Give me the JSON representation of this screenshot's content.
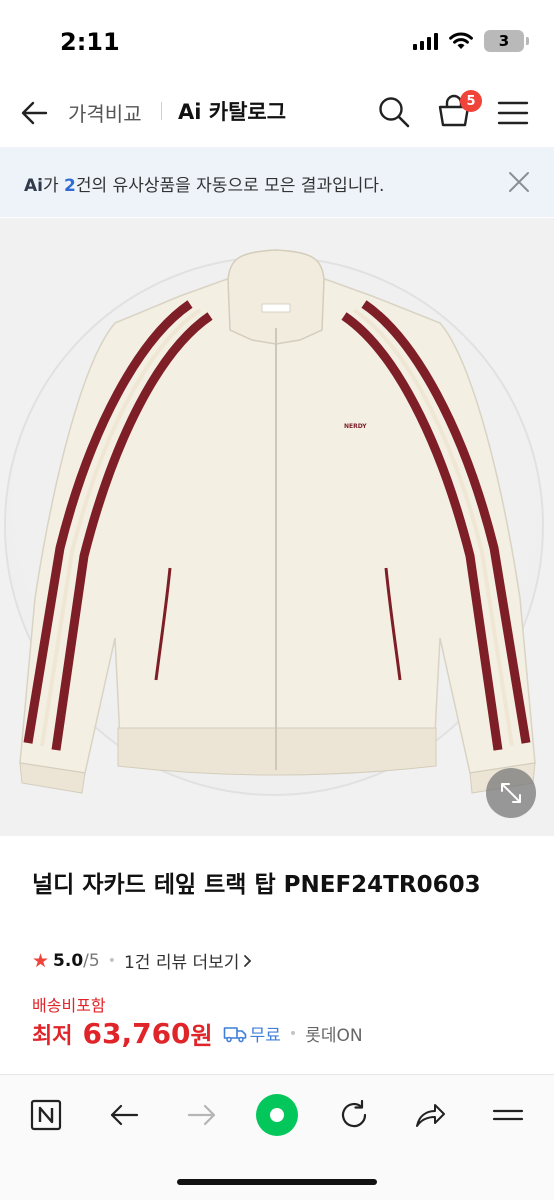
{
  "status_bar": {
    "time": "2:11",
    "battery": "3"
  },
  "nav": {
    "crumb": "가격비교",
    "title": "Ai 카탈로그",
    "cart_count": "5"
  },
  "ai_banner": {
    "logo": "Ai",
    "text_1": "가 ",
    "count": "2",
    "text_2": "건의 유사상품을 자동으로 모은 결과입니다."
  },
  "product": {
    "image_logo": "NERDY",
    "title": "널디 자카드 테잎 트랙 탑 PNEF24TR0603",
    "rating_score": "5.0",
    "rating_max": "/5",
    "review_link": "1건 리뷰 더보기",
    "shipping_label": "배송비포함",
    "price_prefix": "최저",
    "price_value": "63,760",
    "price_unit": "원",
    "free_shipping": "무료",
    "seller": "롯데ON"
  },
  "icons": {
    "back": "arrow-left-icon",
    "search": "search-icon",
    "cart": "cart-icon",
    "menu": "hamburger-menu-icon",
    "close": "close-icon",
    "expand": "expand-icon",
    "star": "star-icon",
    "truck": "truck-icon",
    "browser_home": "naver-n-icon",
    "browser_back": "arrow-left-icon",
    "browser_forward": "arrow-right-icon",
    "browser_center": "green-dot-icon",
    "browser_refresh": "refresh-icon",
    "browser_share": "share-icon",
    "browser_menu": "menu-icon"
  },
  "colors": {
    "accent_red": "#e0252a",
    "badge_red": "#f0443a",
    "ai_blue": "#2f6bd6",
    "naver_green": "#03c75a",
    "banner_bg": "#eef3fa"
  }
}
